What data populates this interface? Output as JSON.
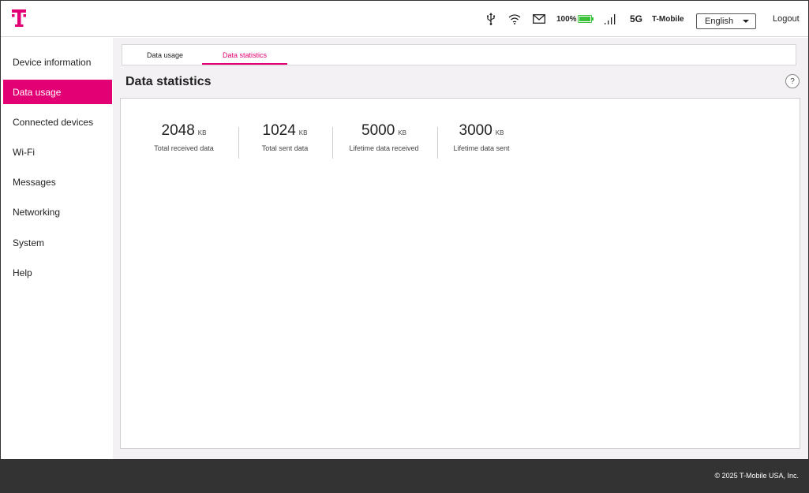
{
  "header": {
    "logo": "t-mobile-logo-icon",
    "battery": "100%",
    "network": "5G",
    "carrier": "T-Mobile",
    "language": "English",
    "logout": "Logout",
    "icons": [
      "usb-icon",
      "wifi-icon",
      "mail-icon",
      "battery-icon",
      "signal-icon"
    ],
    "brand_color": "#e20074",
    "battery_color": "#3cc13b"
  },
  "sidebar": {
    "items": [
      {
        "label": "Device information",
        "active": false
      },
      {
        "label": "Data usage",
        "active": true
      },
      {
        "label": "Connected devices",
        "active": false
      },
      {
        "label": "Wi-Fi",
        "active": false
      },
      {
        "label": "Messages",
        "active": false
      },
      {
        "label": "Networking",
        "active": false
      },
      {
        "label": "System",
        "active": false
      },
      {
        "label": "Help",
        "active": false
      }
    ]
  },
  "main": {
    "tabs": [
      {
        "label": "Data usage",
        "active": false
      },
      {
        "label": "Data statistics",
        "active": true
      }
    ],
    "title": "Data statistics",
    "help": "?",
    "stats": [
      {
        "value": "2048",
        "unit": "KB",
        "label": "Total received data"
      },
      {
        "value": "1024",
        "unit": "KB",
        "label": "Total sent data"
      },
      {
        "value": "5000",
        "unit": "KB",
        "label": "Lifetime data received"
      },
      {
        "value": "3000",
        "unit": "KB",
        "label": "Lifetime data sent"
      }
    ]
  },
  "footer": {
    "copyright": "© 2025 T-Mobile USA, Inc."
  }
}
